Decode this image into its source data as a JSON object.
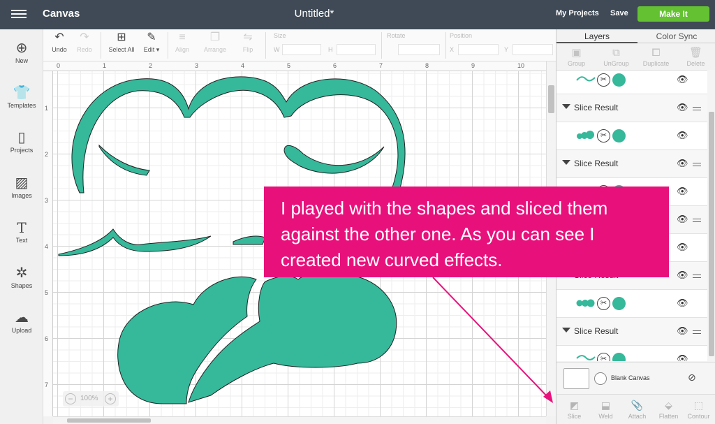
{
  "topbar": {
    "app_title": "Canvas",
    "doc_title": "Untitled*",
    "my_projects": "My Projects",
    "save": "Save",
    "make_it": "Make It"
  },
  "toolbar": {
    "undo": "Undo",
    "redo": "Redo",
    "select_all": "Select All",
    "edit": "Edit",
    "align": "Align",
    "arrange": "Arrange",
    "flip": "Flip",
    "size": "Size",
    "w": "W",
    "h": "H",
    "rotate": "Rotate",
    "position": "Position",
    "x": "X",
    "y": "Y"
  },
  "sidebar": {
    "items": [
      {
        "label": "New",
        "icon": "plus-circle-icon"
      },
      {
        "label": "Templates",
        "icon": "shirt-icon"
      },
      {
        "label": "Projects",
        "icon": "book-icon"
      },
      {
        "label": "Images",
        "icon": "image-icon"
      },
      {
        "label": "Text",
        "icon": "text-icon"
      },
      {
        "label": "Shapes",
        "icon": "shapes-icon"
      },
      {
        "label": "Upload",
        "icon": "upload-icon"
      }
    ]
  },
  "ruler": {
    "x_ticks": [
      "0",
      "1",
      "2",
      "3",
      "4",
      "5",
      "6",
      "7",
      "8",
      "9",
      "10"
    ],
    "y_ticks": [
      "1",
      "2",
      "3",
      "4",
      "5",
      "6",
      "7"
    ]
  },
  "zoom": {
    "value": "100%"
  },
  "panel": {
    "tabs": [
      "Layers",
      "Color Sync"
    ],
    "top_actions": [
      "Group",
      "UnGroup",
      "Duplicate",
      "Delete"
    ],
    "group_label": "Slice Result",
    "blank_canvas": "Blank Canvas",
    "bottom_actions": [
      "Slice",
      "Weld",
      "Attach",
      "Flatten",
      "Contour"
    ]
  },
  "colors": {
    "shape_fill": "#36b89a",
    "make_it": "#63c132",
    "annotation": "#e8117c",
    "topbar": "#3f4a56"
  },
  "annotation": {
    "text": "I played with the shapes and sliced them against the other one. As you can see I created new curved effects."
  }
}
